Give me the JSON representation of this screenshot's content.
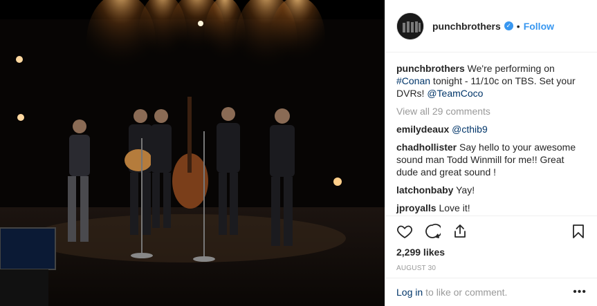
{
  "post": {
    "username": "punchbrothers",
    "follow_label": "Follow",
    "dot": "•",
    "caption": {
      "user": "punchbrothers",
      "text_1": " We're performing on ",
      "hashtag": "#Conan",
      "text_2": " tonight - 11/10c on TBS. Set your DVRs! ",
      "mention": "@TeamCoco"
    },
    "view_all": "View all 29 comments",
    "comments": [
      {
        "user": "emilydeaux",
        "text": "",
        "mention": "@cthib9"
      },
      {
        "user": "chadhollister",
        "text": " Say hello to your awesome sound man Todd Winmill for me!! Great dude and great sound !",
        "mention": ""
      },
      {
        "user": "latchonbaby",
        "text": " Yay!",
        "mention": ""
      },
      {
        "user": "jproyalls",
        "text": " Love it!",
        "mention": ""
      }
    ],
    "likes": "2,299 likes",
    "date": "AUGUST 30",
    "login_link": "Log in",
    "login_text": "to like or comment.",
    "more": "•••"
  },
  "icons": {
    "like": "heart-icon",
    "comment": "comment-icon",
    "share": "share-icon",
    "save": "bookmark-icon",
    "verified": "verified-badge-icon"
  },
  "colors": {
    "link_blue": "#3897f0",
    "text": "#262626",
    "muted": "#999999",
    "dark_link": "#003569"
  }
}
